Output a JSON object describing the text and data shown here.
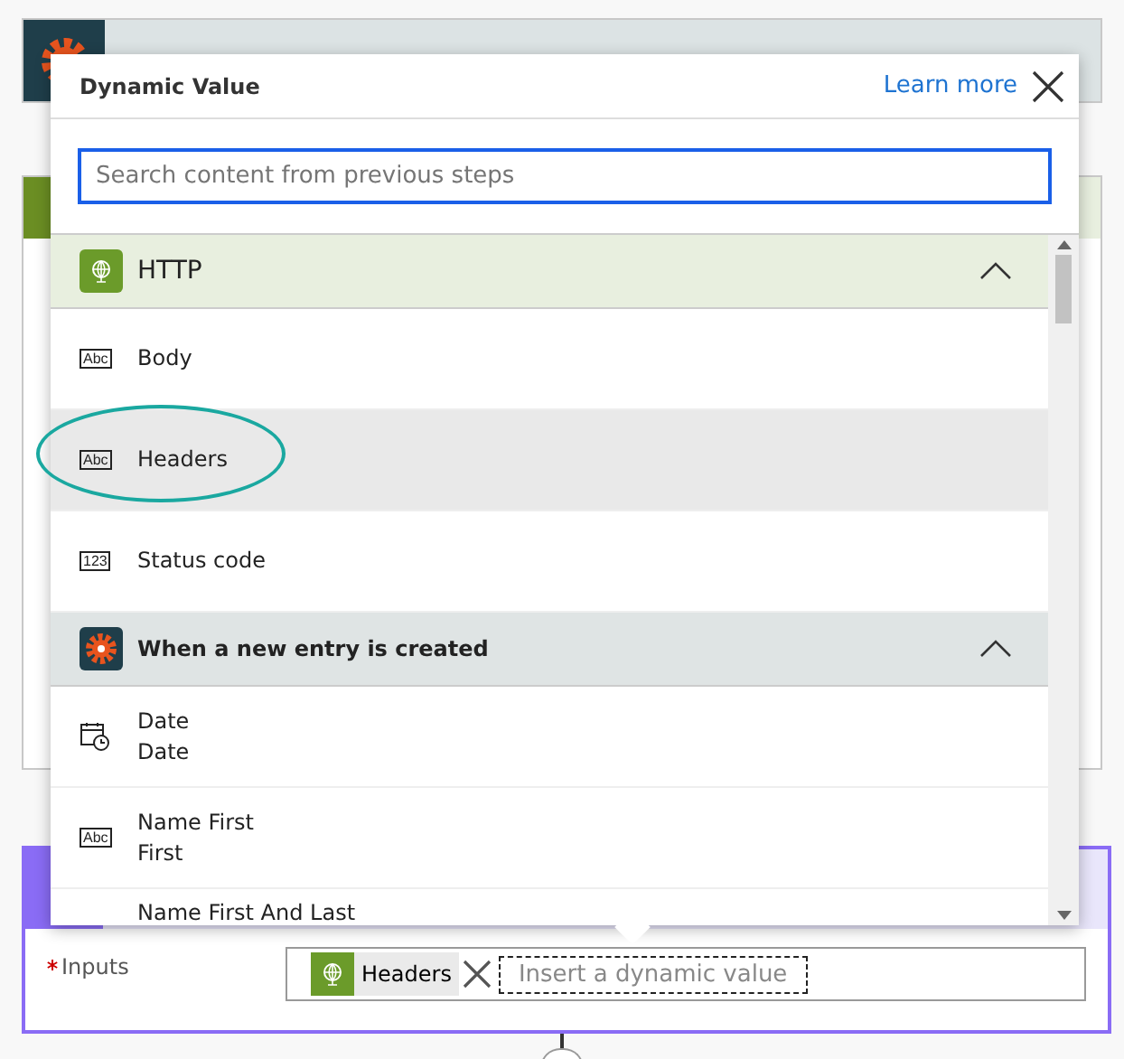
{
  "form": {
    "inputs_label": "Inputs",
    "required": true,
    "token": {
      "label": "Headers"
    },
    "placeholder": "Insert a dynamic value"
  },
  "popup": {
    "title": "Dynamic Value",
    "learn_more": "Learn more",
    "search": {
      "placeholder": "Search content from previous steps"
    },
    "groups": [
      {
        "title": "HTTP",
        "kind": "http",
        "expanded": true,
        "items": [
          {
            "label": "Body",
            "kind": "text",
            "type_label": "Abc",
            "highlighted": false
          },
          {
            "label": "Headers",
            "kind": "text",
            "type_label": "Abc",
            "highlighted": true
          },
          {
            "label": "Status code",
            "kind": "number",
            "type_label": "123",
            "highlighted": false
          }
        ]
      },
      {
        "title": "When a new entry is created",
        "kind": "trigger",
        "expanded": true,
        "items": [
          {
            "label": "Date",
            "description": "Date",
            "kind": "date",
            "highlighted": false
          },
          {
            "label": "Name First",
            "description": "First",
            "kind": "text",
            "type_label": "Abc",
            "highlighted": false
          },
          {
            "label": "Name First And Last",
            "kind": "none",
            "highlighted": false
          }
        ]
      }
    ]
  }
}
